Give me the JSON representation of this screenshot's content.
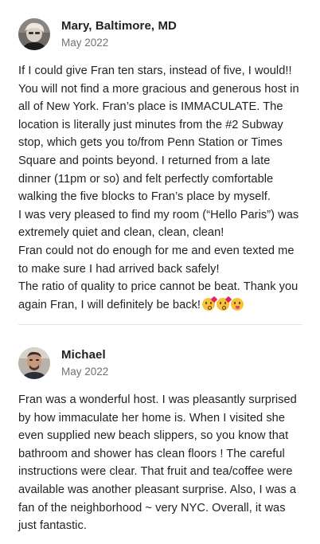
{
  "reviews": [
    {
      "name": "Mary, Baltimore, MD",
      "date": "May 2022",
      "paragraphs": [
        "If I could give Fran ten stars, instead of five, I would!! You will not find a more gracious and generous host in all of New York. Fran’s place is IMMACULATE. The location is literally just minutes from the #2 Subway stop, which gets you to/from Penn Station or Times Square and points beyond. I returned from a late dinner (11pm or so) and felt perfectly comfortable walking the five blocks to Fran’s place by myself.",
        "I was very pleased to find my room (“Hello Paris”) was extremely quiet and clean, clean, clean!",
        "Fran could not do enough for me and even texted me to make sure I had arrived back safely!",
        "The ratio of quality to price cannot be beat. Thank you again Fran, I will definitely be back!"
      ],
      "emojis": [
        "face-blowing-kiss-emoji",
        "face-blowing-kiss-emoji",
        "face-with-tongue-emoji"
      ]
    },
    {
      "name": "Michael",
      "date": "May 2022",
      "paragraphs": [
        "Fran was a wonderful host. I was pleasantly surprised by how immaculate her home is. When I visited she even supplied new beach slippers, so you know that bathroom and shower has clean floors ! The careful instructions were clear. That fruit and tea/coffee were available was another pleasant surprise. Also, I was a fan of the neighborhood ~ very NYC.  Overall, it was just fantastic."
      ]
    }
  ],
  "colors": {
    "text": "#222222",
    "secondary_text": "#717171",
    "divider": "#e4e4e4"
  }
}
